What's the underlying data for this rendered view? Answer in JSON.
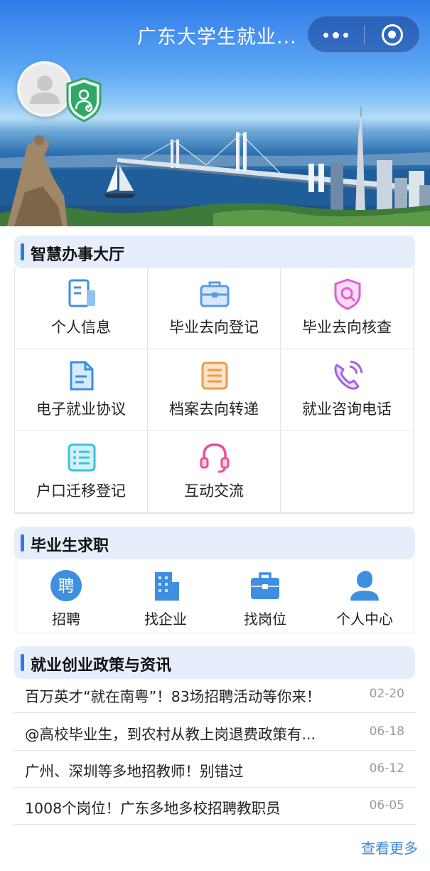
{
  "header": {
    "title": "广东大学生就业..."
  },
  "colors": {
    "brand_blue": "#2f7be8",
    "section_bg": "#e6eefb",
    "link": "#3d86d9"
  },
  "sections": {
    "services": {
      "title": "智慧办事大厅",
      "items": [
        {
          "label": "个人信息",
          "icon": "profile-document-icon"
        },
        {
          "label": "毕业去向登记",
          "icon": "briefcase-icon"
        },
        {
          "label": "毕业去向核查",
          "icon": "search-shield-icon"
        },
        {
          "label": "电子就业协议",
          "icon": "document-icon"
        },
        {
          "label": "档案去向转递",
          "icon": "archive-icon"
        },
        {
          "label": "就业咨询电话",
          "icon": "phone-icon"
        },
        {
          "label": "户口迁移登记",
          "icon": "list-icon"
        },
        {
          "label": "互动交流",
          "icon": "headset-icon"
        }
      ]
    },
    "jobs": {
      "title": "毕业生求职",
      "items": [
        {
          "label": "招聘",
          "icon": "recruit-icon",
          "glyph": "聘"
        },
        {
          "label": "找企业",
          "icon": "building-icon"
        },
        {
          "label": "找岗位",
          "icon": "briefcase-icon"
        },
        {
          "label": "个人中心",
          "icon": "user-icon"
        }
      ]
    },
    "news": {
      "title": "就业创业政策与资讯",
      "items": [
        {
          "title": "百万英才“就在南粤”！83场招聘活动等你来！",
          "date": "02-20"
        },
        {
          "title": "@高校毕业生，到农村从教上岗退费政策有...",
          "date": "06-18"
        },
        {
          "title": "广州、深圳等多地招教师！别错过",
          "date": "06-12"
        },
        {
          "title": "1008个岗位！广东多地多校招聘教职员",
          "date": "06-05"
        }
      ],
      "more_label": "查看更多"
    }
  }
}
